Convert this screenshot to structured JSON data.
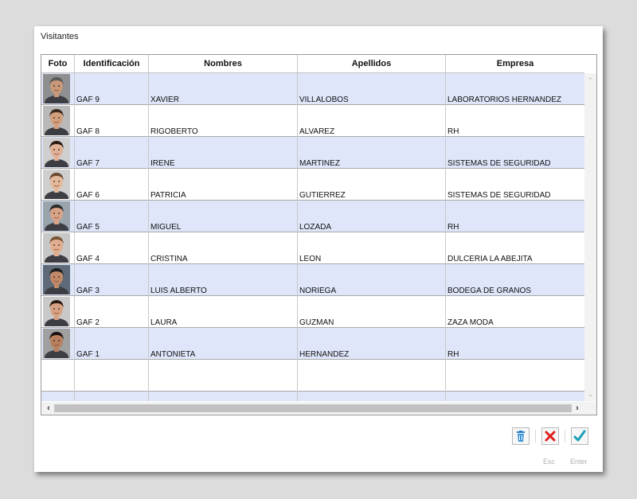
{
  "window": {
    "title": "Visitantes"
  },
  "grid": {
    "columns": [
      "Foto",
      "Identificación",
      "Nombres",
      "Apellidos",
      "Empresa"
    ],
    "rows": [
      {
        "id": "GAF 9",
        "nombres": "XAVIER",
        "apellidos": "VILLALOBOS",
        "empresa": "LABORATORIOS HERNANDEZ"
      },
      {
        "id": "GAF 8",
        "nombres": "RIGOBERTO",
        "apellidos": "ALVAREZ",
        "empresa": "RH"
      },
      {
        "id": "GAF 7",
        "nombres": "IRENE",
        "apellidos": "MARTINEZ",
        "empresa": "SISTEMAS DE SEGURIDAD"
      },
      {
        "id": "GAF 6",
        "nombres": "PATRICIA",
        "apellidos": "GUTIERREZ",
        "empresa": "SISTEMAS DE SEGURIDAD"
      },
      {
        "id": "GAF 5",
        "nombres": " MIGUEL",
        "apellidos": "LOZADA",
        "empresa": "RH"
      },
      {
        "id": "GAF 4",
        "nombres": "CRISTINA",
        "apellidos": "LEON",
        "empresa": "DULCERIA LA ABEJITA"
      },
      {
        "id": "GAF 3",
        "nombres": "LUIS ALBERTO",
        "apellidos": "NORIEGA",
        "empresa": "BODEGA DE GRANOS"
      },
      {
        "id": "GAF 2",
        "nombres": "LAURA",
        "apellidos": "GUZMAN",
        "empresa": "ZAZA MODA"
      },
      {
        "id": "GAF 1",
        "nombres": "ANTONIETA",
        "apellidos": "HERNANDEZ",
        "empresa": "RH"
      }
    ]
  },
  "actions": {
    "delete": {
      "icon": "trash-icon"
    },
    "cancel": {
      "icon": "close-icon",
      "caption": "Esc",
      "color": "#e02020"
    },
    "accept": {
      "icon": "check-icon",
      "caption": "Enter",
      "color": "#1aa0b8"
    }
  }
}
